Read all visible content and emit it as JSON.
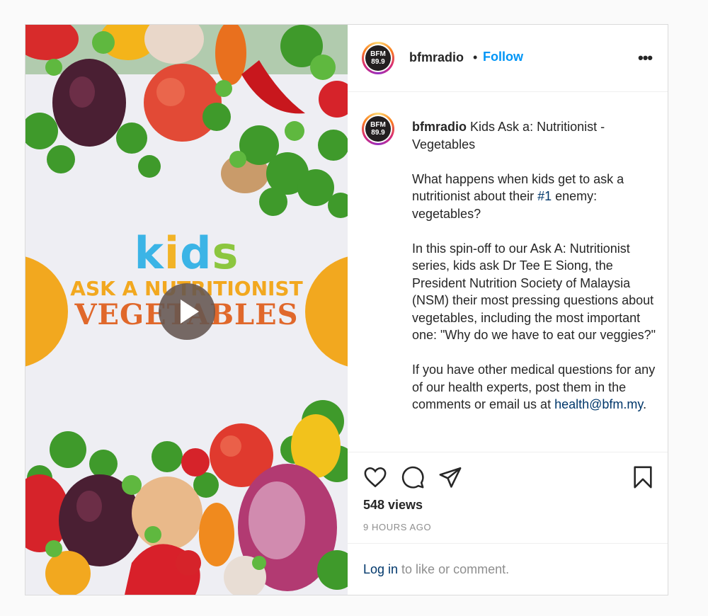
{
  "post": {
    "author": "bfmradio",
    "avatar_text": [
      "BFM",
      "89.9"
    ],
    "follow_label": "Follow",
    "more_label": "•••",
    "media": {
      "title_kids": [
        "k",
        "i",
        "d",
        "s"
      ],
      "title_line1": "ASK A NUTRITIONIST",
      "title_line2": "VEGETABLES"
    },
    "caption": {
      "username": "bfmradio",
      "title": "Kids Ask a: Nutritionist - Vegetables",
      "p1_before": "What happens when kids get to ask a nutritionist about their ",
      "p1_hashtag": "#1",
      "p1_after": " enemy: vegetables?",
      "p2": "In this spin-off to our Ask A: Nutritionist series, kids ask Dr Tee E Siong, the President Nutrition Society of Malaysia (NSM) their most pressing questions about vegetables, including the most important one: \"Why do we have to eat our veggies?\"",
      "p3_before": "If you have other medical questions for any of our health experts, post them in the comments or email us at ",
      "p3_email": "health@bfm.my",
      "p3_after": "."
    },
    "icons": [
      "heart-icon",
      "comment-icon",
      "share-icon",
      "bookmark-icon"
    ],
    "views": "548 views",
    "time": "9 HOURS AGO",
    "login_link": "Log in",
    "login_suffix": " to like or comment."
  },
  "colors": {
    "follow": "#0095f6",
    "link": "#00376b",
    "muted": "#8e8e8e"
  }
}
